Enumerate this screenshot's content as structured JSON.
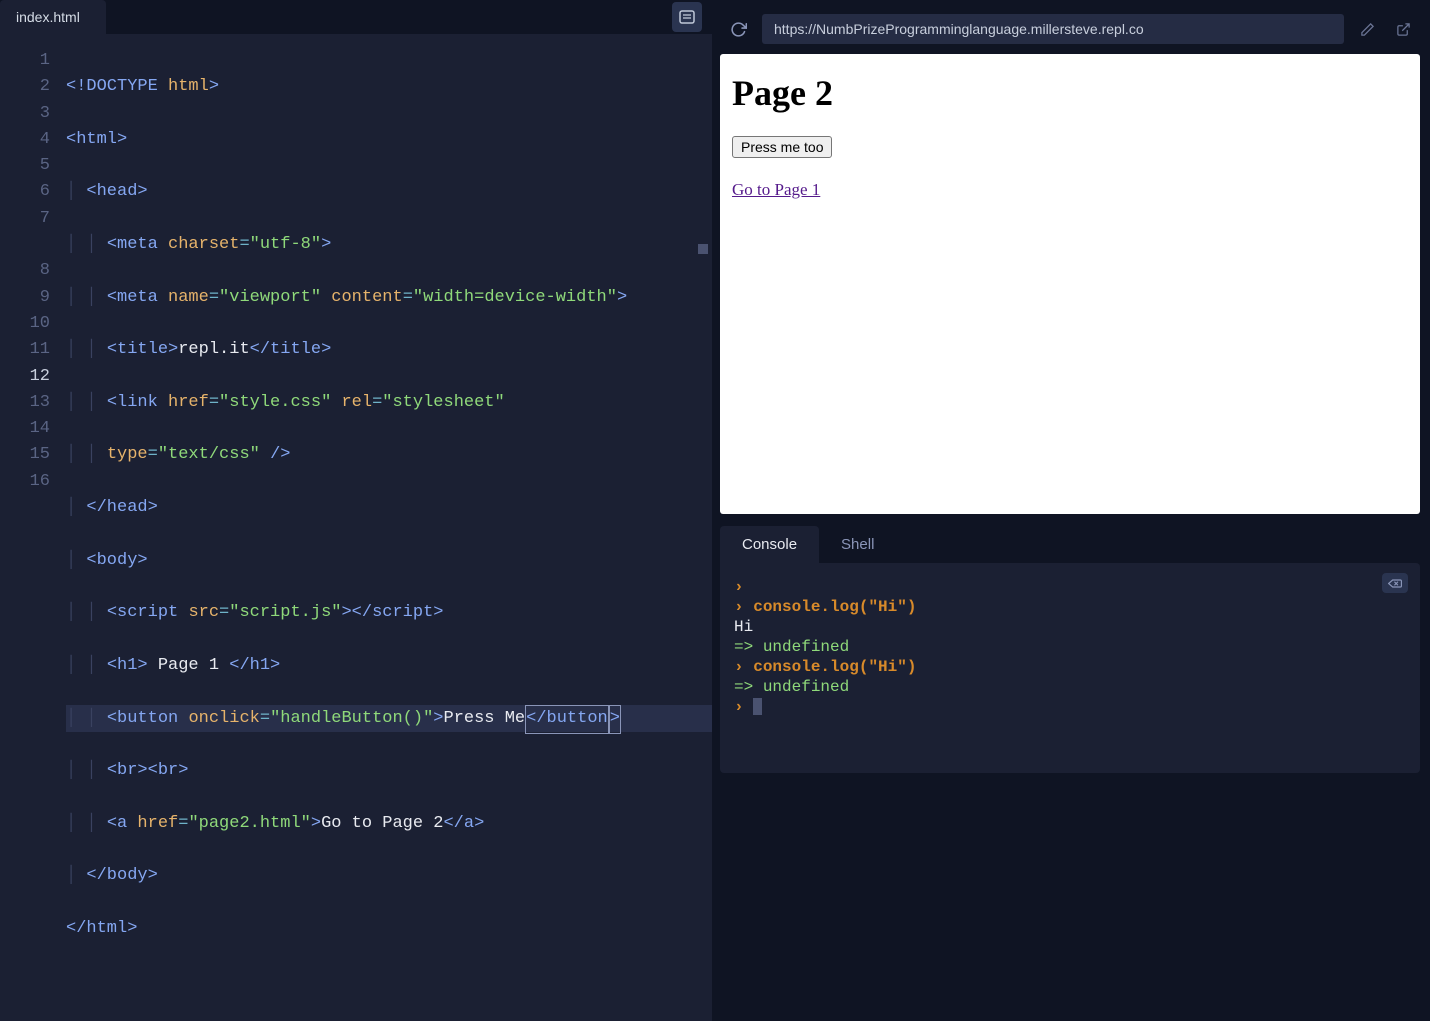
{
  "editor": {
    "tab_name": "index.html",
    "line_numbers": [
      "1",
      "2",
      "3",
      "4",
      "5",
      "6",
      "7",
      "",
      "8",
      "9",
      "10",
      "11",
      "12",
      "13",
      "14",
      "15",
      "16"
    ],
    "active_line": 12,
    "code": {
      "l1": {
        "doctype": "<!DOCTYPE",
        "name": "html",
        "close": ">"
      },
      "l2": {
        "open": "<html>",
        "close_tag": "</html>"
      },
      "l3": "<head>",
      "l4": {
        "tag": "meta",
        "attr1": "charset",
        "val1": "\"utf-8\""
      },
      "l5": {
        "tag": "meta",
        "attr1": "name",
        "val1": "\"viewport\"",
        "attr2": "content",
        "val2": "\"width=device-width\""
      },
      "l6": {
        "open": "<title>",
        "text": "repl.it",
        "close": "</title>"
      },
      "l7a": {
        "tag": "link",
        "attr1": "href",
        "val1": "\"style.css\"",
        "attr2": "rel",
        "val2": "\"stylesheet\""
      },
      "l7b": {
        "attr1": "type",
        "val1": "\"text/css\"",
        "slashclose": "/>"
      },
      "l8": "</head>",
      "l9": "<body>",
      "l10": {
        "open": "<script",
        "attr1": "src",
        "val1": "\"script.js\"",
        "close1": ">",
        "close2": "</script>"
      },
      "l11": {
        "open": "<h1>",
        "text": " Page 1 ",
        "close": "</h1>"
      },
      "l12": {
        "open": "<button",
        "attr1": "onclick",
        "val1": "\"handleButton()\"",
        "gt": ">",
        "text": "Press Me",
        "close": "</button",
        "tail": ">"
      },
      "l13": "<br><br>",
      "l14": {
        "open": "<a",
        "attr1": "href",
        "val1": "\"page2.html\"",
        "gt": ">",
        "text": "Go to Page 2",
        "close": "</a>"
      },
      "l15": "</body>"
    }
  },
  "browser": {
    "url": "https://NumbPrizeProgramminglanguage.millersteve.repl.co",
    "preview": {
      "heading": "Page 2",
      "button_label": "Press me too",
      "link_text": "Go to Page 1"
    }
  },
  "console": {
    "tabs": {
      "console": "Console",
      "shell": "Shell"
    },
    "lines": [
      {
        "type": "prompt",
        "text": ""
      },
      {
        "type": "cmd",
        "text": "console.log(\"Hi\")"
      },
      {
        "type": "output",
        "text": "Hi"
      },
      {
        "type": "return",
        "text": "undefined"
      },
      {
        "type": "cmd",
        "text": "console.log(\"Hi\")"
      },
      {
        "type": "return",
        "text": "undefined"
      }
    ]
  }
}
